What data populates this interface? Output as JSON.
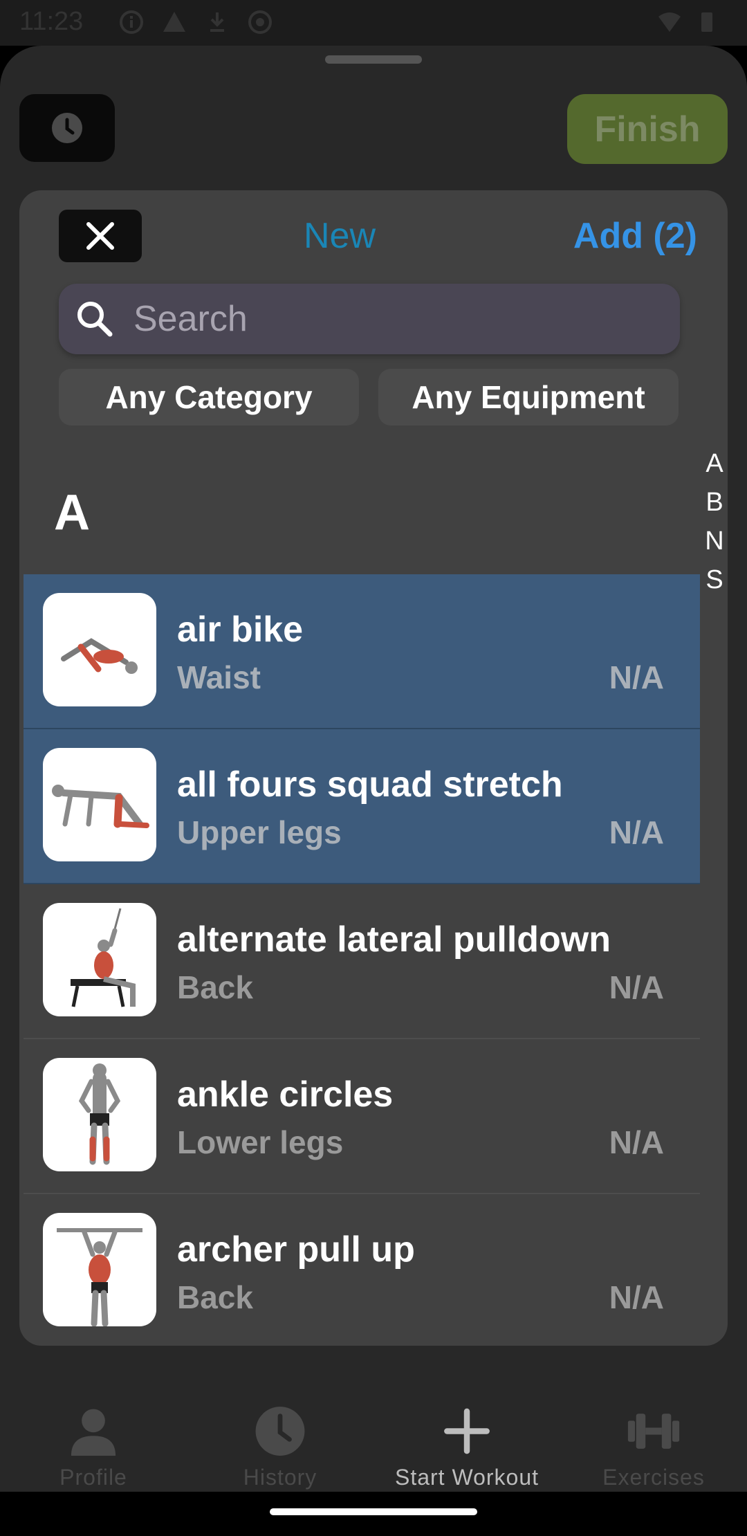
{
  "status_bar": {
    "time": "11:23"
  },
  "header": {
    "finish_label": "Finish"
  },
  "modal": {
    "new_label": "New",
    "add_label": "Add (2)",
    "search_placeholder": "Search",
    "filter_category": "Any Category",
    "filter_equipment": "Any Equipment",
    "section_letter": "A",
    "alpha_index": [
      "A",
      "B",
      "N",
      "S"
    ],
    "exercises": [
      {
        "name": "air bike",
        "category": "Waist",
        "equipment": "N/A",
        "selected": true
      },
      {
        "name": "all fours squad stretch",
        "category": "Upper legs",
        "equipment": "N/A",
        "selected": true
      },
      {
        "name": "alternate lateral pulldown",
        "category": "Back",
        "equipment": "N/A",
        "selected": false
      },
      {
        "name": "ankle circles",
        "category": "Lower legs",
        "equipment": "N/A",
        "selected": false
      },
      {
        "name": "archer pull up",
        "category": "Back",
        "equipment": "N/A",
        "selected": false
      }
    ]
  },
  "bottom_nav": {
    "items": [
      {
        "label": "Profile",
        "icon": "person-icon",
        "active": false
      },
      {
        "label": "History",
        "icon": "clock-icon",
        "active": false
      },
      {
        "label": "Start Workout",
        "icon": "plus-icon",
        "active": true
      },
      {
        "label": "Exercises",
        "icon": "dumbbell-icon",
        "active": false
      }
    ]
  },
  "colors": {
    "accent": "#3593e6",
    "new_link": "#1a86b6",
    "selected_row": "#3d5b7c",
    "finish_bg": "#54692d"
  }
}
